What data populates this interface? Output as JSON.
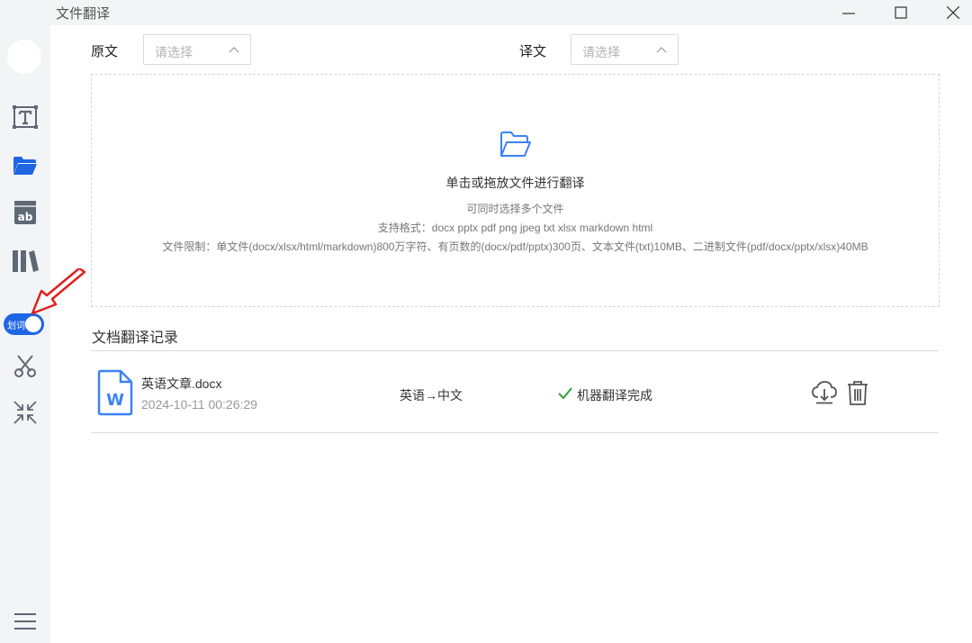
{
  "window": {
    "title": "文件翻译"
  },
  "toggle": {
    "label": "划词"
  },
  "languages": {
    "source_label": "原文",
    "source_placeholder": "请选择",
    "target_label": "译文",
    "target_placeholder": "请选择"
  },
  "dropzone": {
    "main": "单击或拖放文件进行翻译",
    "multi": "可同时选择多个文件",
    "formats": "支持格式：docx pptx pdf png jpeg txt xlsx markdown html",
    "limits": "文件限制：单文件(docx/xlsx/html/markdown)800万字符、有页数的(docx/pdf/pptx)300页、文本文件(txt)10MB、二进制文件(pdf/docx/pptx/xlsx)40MB"
  },
  "records": {
    "title": "文档翻译记录",
    "items": [
      {
        "name": "英语文章.docx",
        "time": "2024-10-11 00:26:29",
        "direction": "英语→中文",
        "status": "机器翻译完成"
      }
    ]
  },
  "colors": {
    "accent": "#1f66e5",
    "success": "#2ea043",
    "annotation_arrow": "#e02020"
  },
  "icons": [
    "text-icon",
    "folder-icon",
    "ab-document-icon",
    "library-icon",
    "scissors-icon",
    "collapse-icon",
    "menu-icon",
    "download-cloud-icon",
    "trash-icon",
    "word-file-icon",
    "check-icon"
  ]
}
